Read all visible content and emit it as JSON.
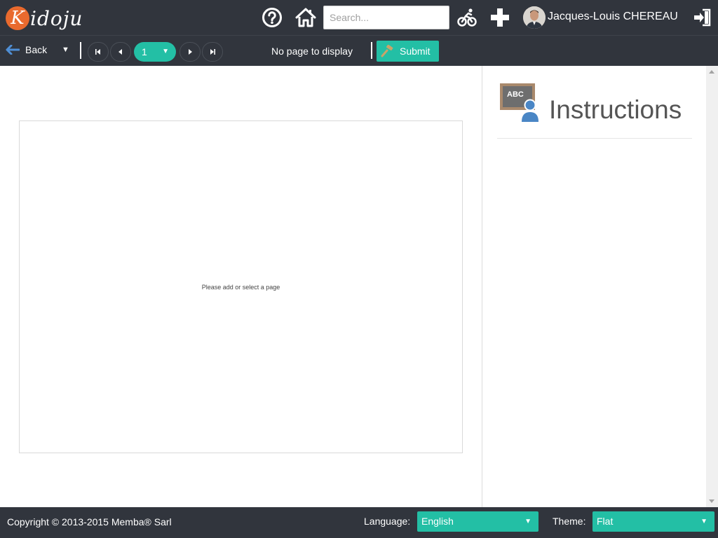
{
  "app": {
    "logo_initial": "K",
    "logo_rest": "idoju"
  },
  "header": {
    "search_placeholder": "Search...",
    "username": "Jacques-Louis CHEREAU",
    "icons": [
      "help-icon",
      "home-icon",
      "cyclist-icon",
      "plus-icon",
      "avatar",
      "sign-out-icon"
    ]
  },
  "toolbar": {
    "back_label": "Back",
    "back_caret": "▼",
    "page_number": "1",
    "page_caret": "▼",
    "status": "No page to display",
    "submit_label": "Submit"
  },
  "stage": {
    "message": "Please add or select a page"
  },
  "sidebar": {
    "title": "Instructions",
    "icon_text": "ABC"
  },
  "footer": {
    "copyright": "Copyright © 2013-2015 Memba® Sarl",
    "language_label": "Language:",
    "language_value": "English",
    "theme_label": "Theme:",
    "theme_value": "Flat",
    "caret": "▼"
  },
  "colors": {
    "bar": "#31353d",
    "accent": "#23bfa5",
    "logo": "#e96a2e",
    "back_arrow": "#4f8fd6"
  }
}
